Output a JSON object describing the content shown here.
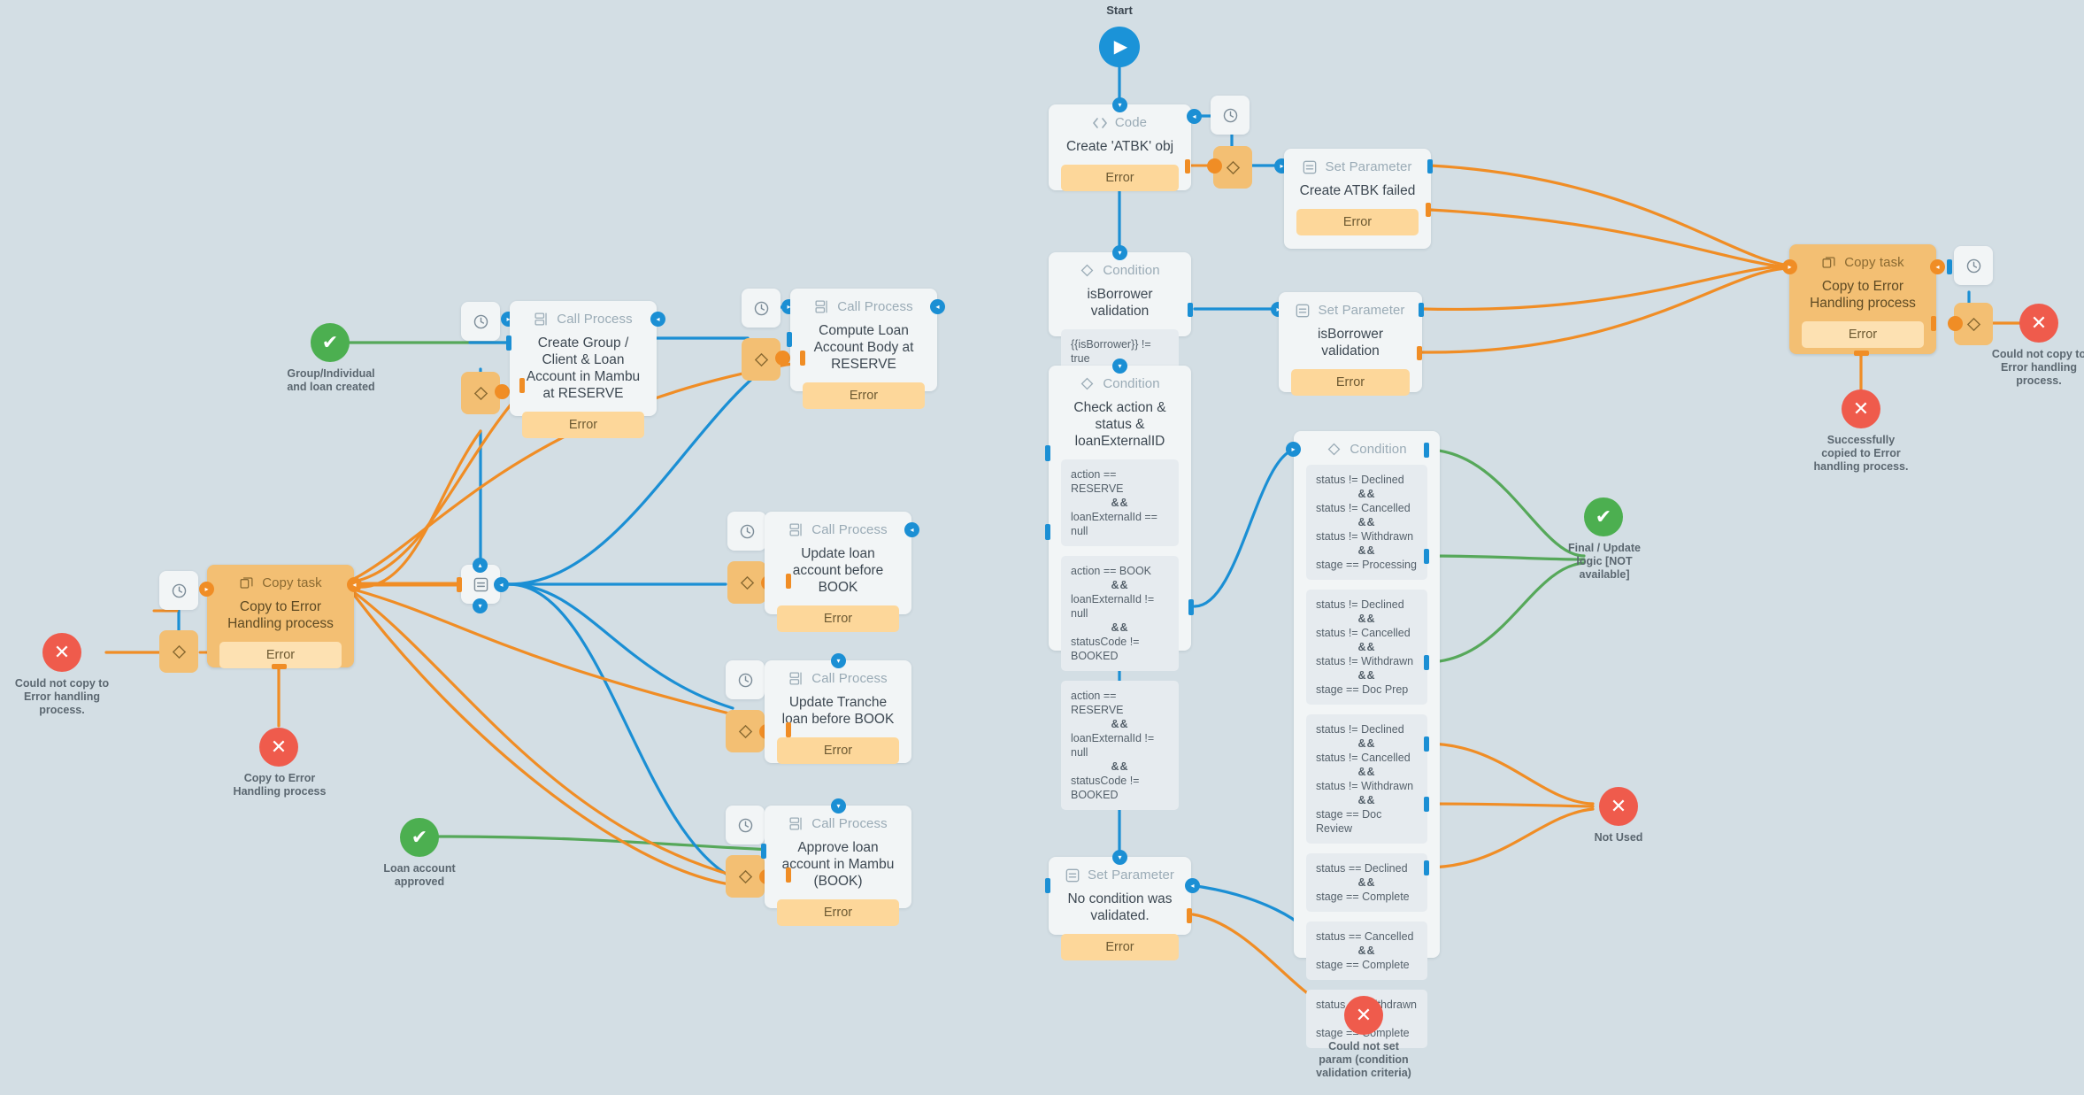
{
  "canvas": {
    "background": "#d3dee4",
    "colors": {
      "blue": "#1b8fd4",
      "orange": "#f08d25",
      "green": "#56a85a",
      "red": "#ef5b4c",
      "card": "#f2f5f6",
      "error_band": "#fdd79a",
      "copy_task": "#f3bf73"
    }
  },
  "start": {
    "label": "Start",
    "icon": "play-icon"
  },
  "nodes": {
    "create_atbk": {
      "kind": "Code",
      "icon": "code-icon",
      "title": "Create 'ATBK' obj",
      "error_label": "Error"
    },
    "create_atbk_failed": {
      "kind": "Set Parameter",
      "icon": "set-parameter-icon",
      "title": "Create ATBK failed",
      "error_label": "Error"
    },
    "isborrower_condition": {
      "kind": "Condition",
      "icon": "condition-icon",
      "title": "isBorrower validation",
      "conditions": [
        "{{isBorrower}} != true"
      ]
    },
    "isborrower_setparam": {
      "kind": "Set Parameter",
      "icon": "set-parameter-icon",
      "title": "isBorrower validation",
      "error_label": "Error"
    },
    "check_action": {
      "kind": "Condition",
      "icon": "condition-icon",
      "title": "Check action & status & loanExternalID",
      "conditions": [
        "action == RESERVE\n&&\nloanExternalId == null",
        "action == BOOK\n&&\nloanExternalId != null\n&&\nstatusCode != BOOKED",
        "action == RESERVE\n&&\nloanExternalId != null\n&&\nstatusCode != BOOKED"
      ]
    },
    "status_condition": {
      "kind": "Condition",
      "icon": "condition-icon",
      "title": "",
      "conditions": [
        "status != Declined\n&&\nstatus != Cancelled\n&&\nstatus != Withdrawn\n&&\nstage == Processing",
        "status != Declined\n&&\nstatus != Cancelled\n&&\nstatus != Withdrawn\n&&\nstage == Doc Prep",
        "status != Declined\n&&\nstatus != Cancelled\n&&\nstatus != Withdrawn\n&&\nstage == Doc Review",
        "status == Declined\n&&\nstage == Complete",
        "status == Cancelled\n&&\nstage == Complete",
        "status == Withdrawn\n&&\nstage == Complete"
      ]
    },
    "no_condition": {
      "kind": "Set Parameter",
      "icon": "set-parameter-icon",
      "title": "No condition was validated.",
      "error_label": "Error"
    },
    "create_group": {
      "kind": "Call Process",
      "icon": "call-process-icon",
      "title": "Create Group / Client & Loan Account in Mambu at RESERVE",
      "error_label": "Error"
    },
    "compute_body": {
      "kind": "Call Process",
      "icon": "call-process-icon",
      "title": "Compute Loan Account Body at RESERVE",
      "error_label": "Error"
    },
    "update_loan": {
      "kind": "Call Process",
      "icon": "call-process-icon",
      "title": "Update loan account before BOOK",
      "error_label": "Error"
    },
    "update_tranche": {
      "kind": "Call Process",
      "icon": "call-process-icon",
      "title": "Update Tranche loan before BOOK",
      "error_label": "Error"
    },
    "approve_loan": {
      "kind": "Call Process",
      "icon": "call-process-icon",
      "title": "Approve loan account in Mambu (BOOK)",
      "error_label": "Error"
    },
    "copy_task_left": {
      "kind": "Copy task",
      "icon": "copy-task-icon",
      "title": "Copy to Error Handling process",
      "error_label": "Error"
    },
    "copy_task_right": {
      "kind": "Copy task",
      "icon": "copy-task-icon",
      "title": "Copy to Error Handling process",
      "error_label": "Error"
    }
  },
  "terminals": {
    "group_created": {
      "type": "ok",
      "label": "Group/Individual and loan created"
    },
    "loan_approved": {
      "type": "ok",
      "label": "Loan account approved"
    },
    "final_update": {
      "type": "ok",
      "label": "Final / Update logic [NOT available]"
    },
    "not_used": {
      "type": "err",
      "label": "Not Used"
    },
    "could_not_copy_left": {
      "type": "err",
      "label": "Could not copy to Error handling process."
    },
    "copy_to_error_left": {
      "type": "err",
      "label": "Copy to Error Handling process"
    },
    "could_not_copy_right": {
      "type": "err",
      "label": "Could not copy to Error handling process."
    },
    "copied_ok_right": {
      "type": "err",
      "label": "Successfully copied to Error handling process."
    },
    "could_not_set_param": {
      "type": "err",
      "label": "Could not set param (condition validation criteria)"
    }
  },
  "glyphs": {
    "check": "✔",
    "cross": "✕",
    "play": "▶"
  }
}
